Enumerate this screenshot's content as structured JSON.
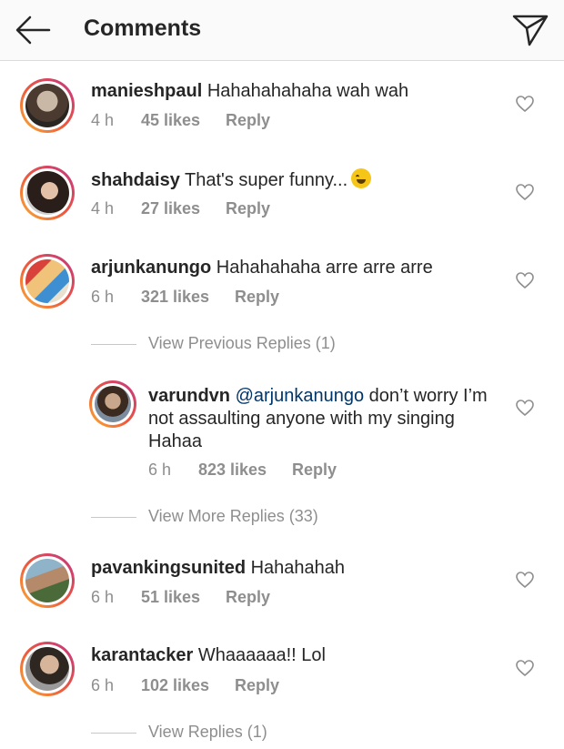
{
  "header": {
    "title": "Comments",
    "back_icon": "arrow-left-icon",
    "send_icon": "paper-plane-icon"
  },
  "colors": {
    "username": "#262626",
    "meta": "#8e8e8e",
    "mention": "#003569",
    "ring_start": "#f9b133",
    "ring_end": "#c13584"
  },
  "comments": [
    {
      "username": "manieshpaul",
      "text": "Hahahahahaha wah wah",
      "time": "4 h",
      "likes": "45 likes",
      "reply": "Reply"
    },
    {
      "username": "shahdaisy",
      "text": "That's super funny...",
      "emoji": "rolling-on-floor-laughing-emoji",
      "time": "4 h",
      "likes": "27 likes",
      "reply": "Reply"
    },
    {
      "username": "arjunkanungo",
      "text": "Hahahahaha arre arre arre",
      "time": "6 h",
      "likes": "321 likes",
      "reply": "Reply"
    },
    {
      "username": "pavankingsunited",
      "text": "Hahahahah",
      "time": "6 h",
      "likes": "51 likes",
      "reply": "Reply"
    },
    {
      "username": "karantacker",
      "text": "Whaaaaaa!! Lol",
      "time": "6 h",
      "likes": "102 likes",
      "reply": "Reply"
    }
  ],
  "thread": {
    "view_previous": "View Previous Replies (1)",
    "view_more": "View More Replies (33)",
    "view_replies": "View Replies (1)"
  },
  "reply": {
    "username": "varundvn",
    "mention": "@arjunkanungo",
    "text_line1": "don’t worry I’m",
    "text_line2": "not assaulting anyone with my singing",
    "text_line3": "Hahaa",
    "time": "6 h",
    "likes": "823 likes",
    "reply": "Reply"
  }
}
